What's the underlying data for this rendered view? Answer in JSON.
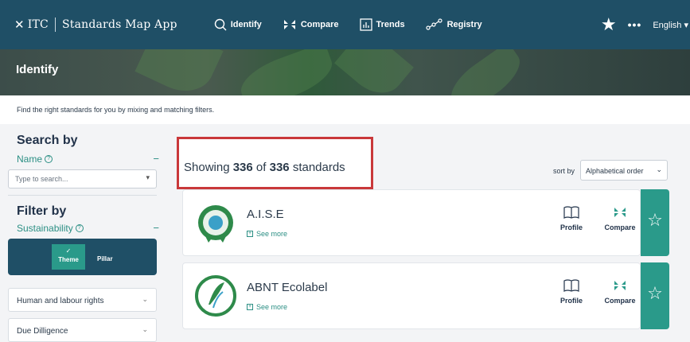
{
  "nav": {
    "brand_prefix": "ITC",
    "brand_name": "Standards Map App",
    "items": [
      {
        "label": "Identify",
        "icon": "search-icon"
      },
      {
        "label": "Compare",
        "icon": "compare-icon"
      },
      {
        "label": "Trends",
        "icon": "trends-icon"
      },
      {
        "label": "Registry",
        "icon": "registry-icon"
      }
    ],
    "language": "English"
  },
  "banner": {
    "title": "Identify"
  },
  "tagline": "Find the right standards for you by mixing and matching filters.",
  "sidebar": {
    "search_title": "Search by",
    "name_label": "Name",
    "name_placeholder": "Type to search...",
    "filter_title": "Filter by",
    "sustainability_label": "Sustainability",
    "toggle": {
      "theme": "Theme",
      "pillar": "Pillar"
    },
    "categories": [
      "Human and labour rights",
      "Due Dilligence"
    ]
  },
  "results": {
    "prefix": "Showing",
    "shown": "336",
    "of": "of",
    "total": "336",
    "suffix": "standards",
    "sort_label": "sort by",
    "sort_value": "Alphabetical order"
  },
  "cards": [
    {
      "name": "A.I.S.E",
      "see_more": "See more",
      "profile": "Profile",
      "compare": "Compare"
    },
    {
      "name": "ABNT Ecolabel",
      "see_more": "See more",
      "profile": "Profile",
      "compare": "Compare"
    }
  ],
  "colors": {
    "nav": "#1f4f66",
    "accent": "#2a9a8a",
    "highlight": "#c9383a"
  }
}
